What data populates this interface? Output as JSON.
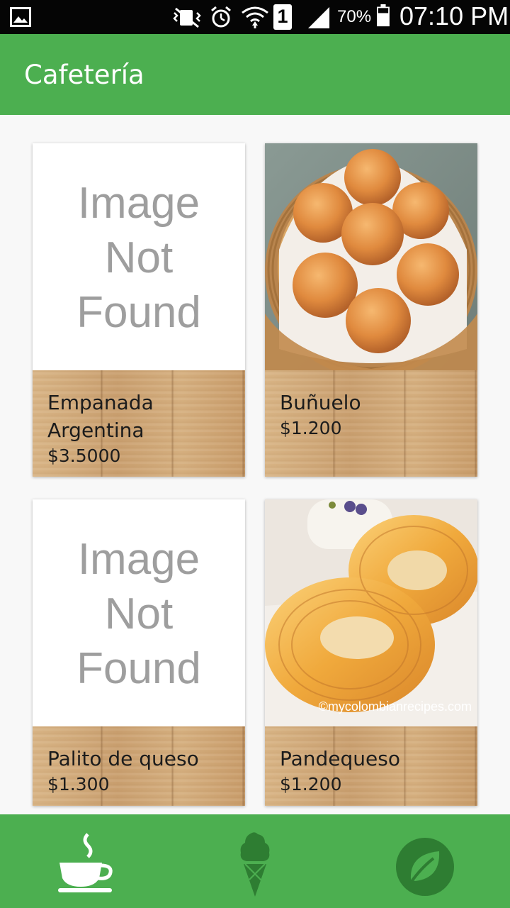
{
  "status_bar": {
    "battery": "70%",
    "time": "07:10 PM",
    "sim_slot": "1",
    "icons": [
      "gallery-icon",
      "mute-vibrate-icon",
      "alarm-icon",
      "wifi-icon",
      "sim-icon",
      "signal-icon",
      "battery-icon"
    ]
  },
  "app_bar": {
    "title": "Cafetería",
    "color": "#4caf50"
  },
  "products": [
    {
      "name": "Empanada Argentina",
      "price": "$3.5000",
      "image": "placeholder",
      "placeholder_text": [
        "Image",
        "Not",
        "Found"
      ]
    },
    {
      "name": "Buñuelo",
      "price": "$1.200",
      "image": "bunuelo-photo"
    },
    {
      "name": "Palito de queso",
      "price": "$1.300",
      "image": "placeholder",
      "placeholder_text": [
        "Image",
        "Not",
        "Found"
      ]
    },
    {
      "name": "Pandequeso",
      "price": "$1.200",
      "image": "pandequeso-photo",
      "watermark": "©mycolombianrecipes.com"
    }
  ],
  "bottom_nav": {
    "items": [
      {
        "icon": "coffee-cup-icon",
        "selected": true
      },
      {
        "icon": "ice-cream-icon",
        "selected": false
      },
      {
        "icon": "leaf-icon",
        "selected": false
      }
    ],
    "selected_color": "#ffffff",
    "unselected_color": "#2e7d32"
  }
}
